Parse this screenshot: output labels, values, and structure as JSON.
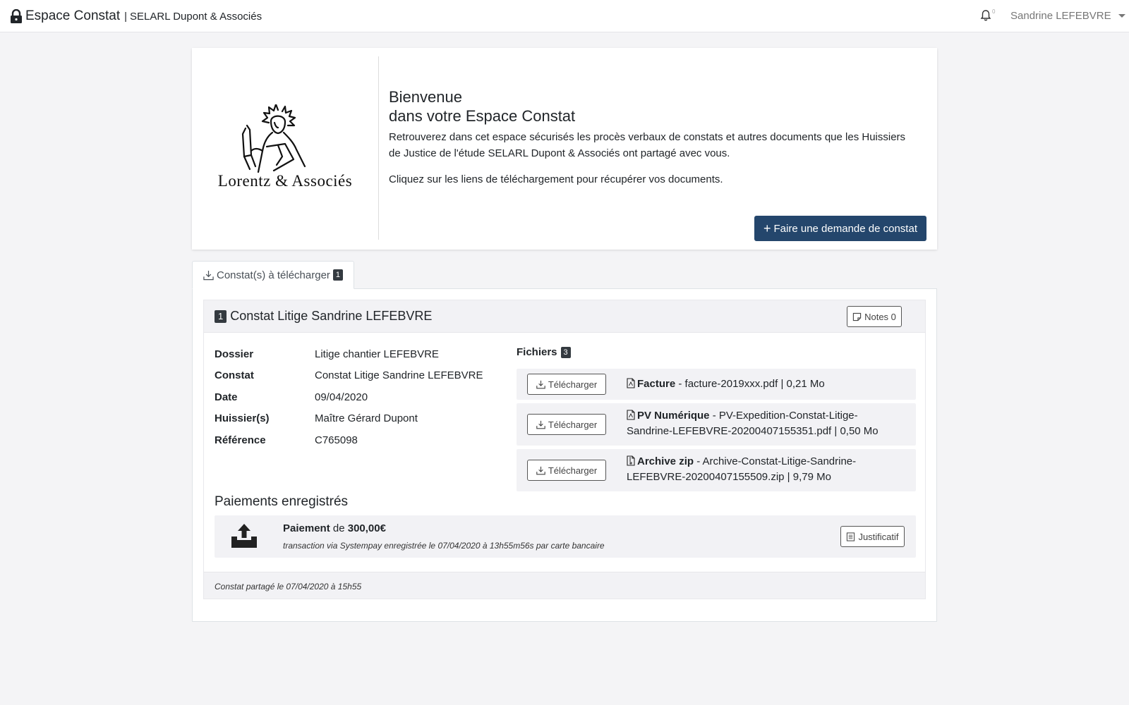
{
  "navbar": {
    "brand_name": "Espace Constat",
    "separator": "|",
    "org": "SELARL Dupont & Associés",
    "notif_count": "0",
    "user_name": "Sandrine LEFEBVRE"
  },
  "welcome": {
    "logo_text": "Lorentz & Associés",
    "title_line1": "Bienvenue",
    "title_line2": "dans votre Espace Constat",
    "paragraph1": "Retrouverez dans cet espace sécurisés les procès verbaux de constats et autres documents que les Huissiers de Justice de l'étude SELARL Dupont & Associés ont partagé avec vous.",
    "paragraph2": "Cliquez sur les liens de téléchargement pour récupérer vos documents.",
    "request_button": "Faire une demande de constat"
  },
  "tab": {
    "label": "Constat(s) à télécharger",
    "count": "1"
  },
  "constat": {
    "index": "1",
    "title": "Constat Litige Sandrine LEFEBVRE",
    "notes_label": "Notes 0",
    "info": [
      {
        "label": "Dossier",
        "value": "Litige chantier LEFEBVRE"
      },
      {
        "label": "Constat",
        "value": "Constat Litige Sandrine LEFEBVRE"
      },
      {
        "label": "Date",
        "value": "09/04/2020"
      },
      {
        "label": "Huissier(s)",
        "value": "Maître Gérard Dupont"
      },
      {
        "label": "Référence",
        "value": "C765098"
      }
    ],
    "files_title": "Fichiers",
    "files_count": "3",
    "download_label": "Télécharger",
    "files": [
      {
        "name": "Facture",
        "detail": "facture-2019xxx.pdf | 0,21 Mo"
      },
      {
        "name": "PV Numérique",
        "detail": "PV-Expedition-Constat-Litige-Sandrine-LEFEBVRE-20200407155351.pdf | 0,50 Mo"
      },
      {
        "name": "Archive zip",
        "detail": "Archive-Constat-Litige-Sandrine-LEFEBVRE-20200407155509.zip | 9,79 Mo"
      }
    ],
    "payments_title": "Paiements enregistrés",
    "payment": {
      "label": "Paiement",
      "of": "de",
      "amount": "300,00€",
      "detail": "transaction via Systempay enregistrée le 07/04/2020 à 13h55m56s par carte bancaire",
      "receipt_label": "Justificatif"
    },
    "footer": "Constat partagé le 07/04/2020 à 15h55"
  }
}
